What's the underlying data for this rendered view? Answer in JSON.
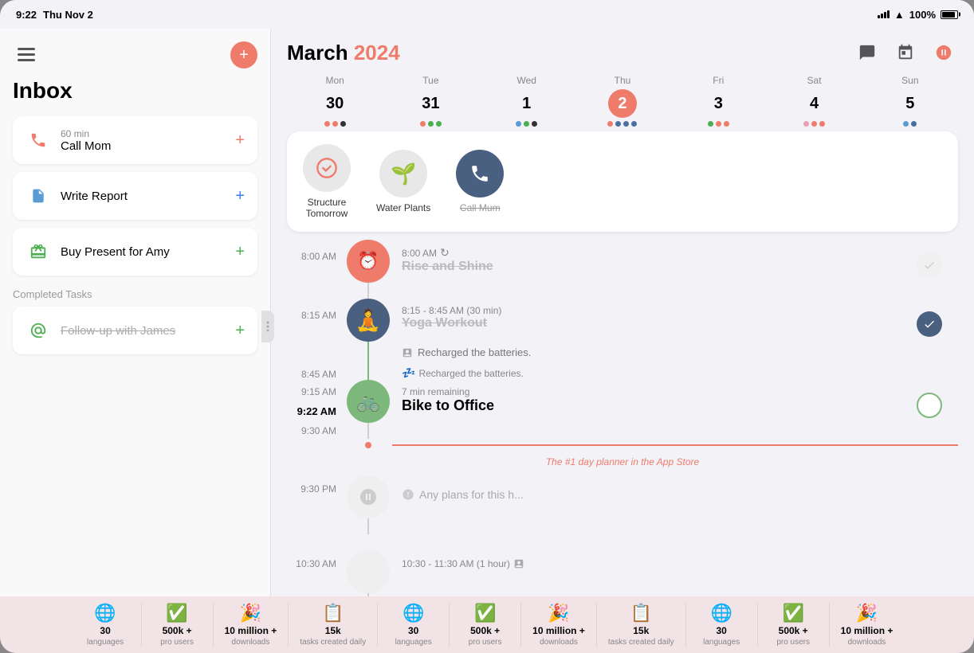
{
  "status_bar": {
    "time": "9:22",
    "day": "Thu Nov 2",
    "battery": "100%",
    "signal_bars": [
      3,
      5,
      7,
      9,
      11
    ]
  },
  "sidebar": {
    "inbox_title": "Inbox",
    "tasks": [
      {
        "icon": "📞",
        "color": "#ef7b6b",
        "label": "Call Mom",
        "sublabel": "60 min",
        "add": "+"
      },
      {
        "icon": "📄",
        "color": "#5b9bd5",
        "label": "Write Report",
        "sublabel": "",
        "add": "+"
      },
      {
        "icon": "🎁",
        "color": "#4caf50",
        "label": "Buy Present for Amy",
        "sublabel": "",
        "add": "+"
      }
    ],
    "completed_label": "Completed Tasks",
    "completed_tasks": [
      {
        "icon": "✉️",
        "label": "Follow-up with James",
        "add": "+"
      }
    ]
  },
  "calendar": {
    "month": "March",
    "year": "2024",
    "week_days": [
      {
        "name": "Mon",
        "num": "30",
        "today": false,
        "dots": [
          "red",
          "red",
          "dark"
        ]
      },
      {
        "name": "Tue",
        "num": "31",
        "today": false,
        "dots": [
          "red",
          "green",
          "green"
        ]
      },
      {
        "name": "Wed",
        "num": "1",
        "today": false,
        "dots": [
          "blue",
          "green",
          "dark"
        ]
      },
      {
        "name": "Thu",
        "num": "2",
        "today": true,
        "dots": [
          "red",
          "navy",
          "navy",
          "navy"
        ]
      },
      {
        "name": "Fri",
        "num": "3",
        "today": false,
        "dots": [
          "green",
          "red",
          "red"
        ]
      },
      {
        "name": "Sat",
        "num": "4",
        "today": false,
        "dots": [
          "pink",
          "red",
          "red"
        ]
      },
      {
        "name": "Sun",
        "num": "5",
        "today": false,
        "dots": [
          "blue",
          "navy"
        ]
      }
    ],
    "habits": [
      {
        "emoji": "✅",
        "bg": "gray",
        "label": "Structure\nTomorrow",
        "strikethrough": false
      },
      {
        "emoji": "🌱",
        "bg": "gray",
        "label": "Water Plants",
        "strikethrough": false
      },
      {
        "emoji": "📞",
        "bg": "navy",
        "label": "Call Mum",
        "strikethrough": true
      }
    ],
    "events": [
      {
        "time": "8:00 AM",
        "icon": "⏰",
        "icon_bg": "red",
        "event_time": "8:00 AM",
        "title": "Rise and Shine",
        "strikethrough": true,
        "recurring": true,
        "check": "gray",
        "has_line": true,
        "line_color": "default"
      },
      {
        "time": "8:15 AM",
        "icon": "🧘",
        "icon_bg": "navy",
        "event_time": "8:15 - 8:45 AM (30 min)",
        "title": "Yoga Workout",
        "strikethrough": true,
        "check": "navy",
        "has_line": true,
        "line_color": "green",
        "note": "Recharged the batteries."
      },
      {
        "time_top": "9:15 AM",
        "time_current": "9:22 AM",
        "time_bottom": "9:30 AM",
        "icon": "🚲",
        "icon_bg": "green",
        "remaining": "7 min remaining",
        "title": "Bike to Office",
        "strikethrough": false,
        "check": "empty"
      },
      {
        "time": "9:30 PM",
        "ghost": true,
        "note": "Any plans for this h..."
      }
    ],
    "promo_text": "The #1 day planner in the App Store",
    "stats": [
      {
        "icon": "🌐",
        "num": "30",
        "label": "languages"
      },
      {
        "icon": "✅",
        "num": "500k +",
        "label": "pro users"
      },
      {
        "icon": "🎉",
        "num": "10 million +",
        "label": "downloads"
      },
      {
        "icon": "📋",
        "num": "15k",
        "label": "tasks created daily"
      },
      {
        "icon": "🌐",
        "num": "30",
        "label": "languages"
      },
      {
        "icon": "✅",
        "num": "500k +",
        "label": "pro users"
      },
      {
        "icon": "🎉",
        "num": "10 million +",
        "label": "downloads"
      },
      {
        "icon": "📋",
        "num": "15k",
        "label": "tasks created daily"
      },
      {
        "icon": "🌐",
        "num": "30",
        "label": "languages"
      },
      {
        "icon": "✅",
        "num": "500k +",
        "label": "pro users"
      },
      {
        "icon": "🎉",
        "num": "10 million +",
        "label": "downloads"
      }
    ]
  }
}
